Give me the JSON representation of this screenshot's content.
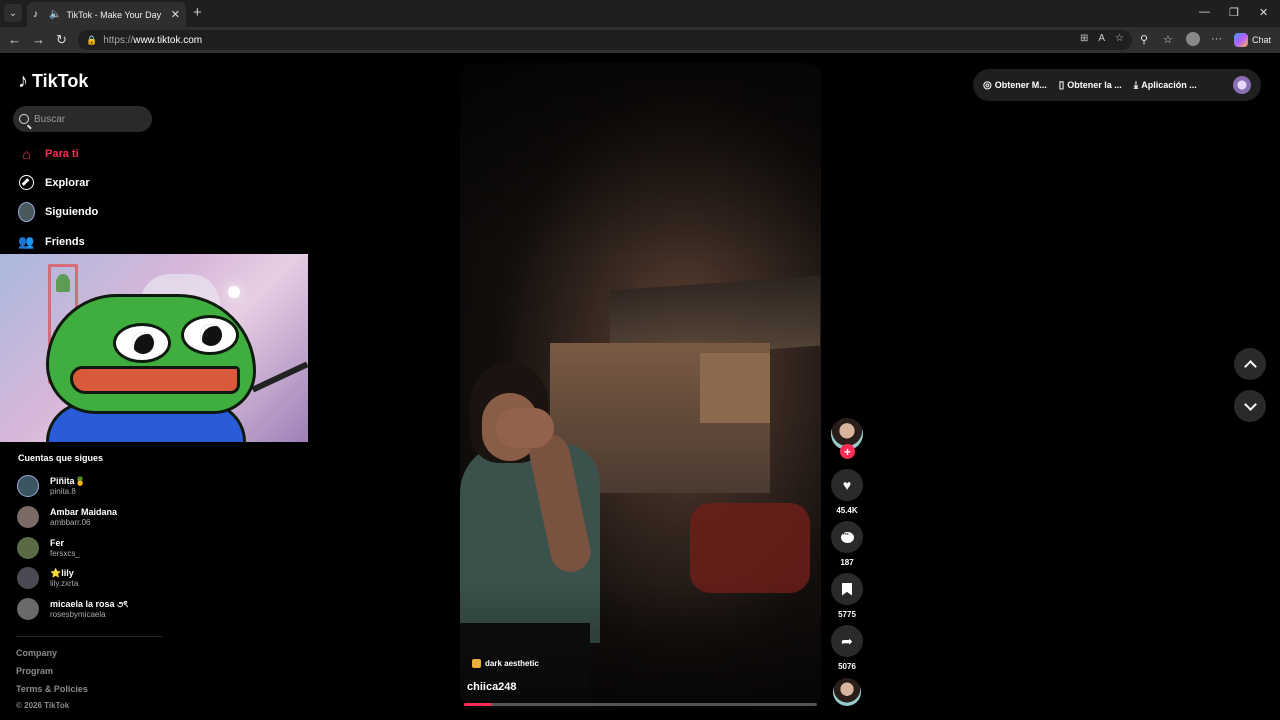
{
  "browser": {
    "tab_title": "TikTok - Make Your Day",
    "url_prefix": "https://",
    "url_domain": "www.tiktok.com",
    "chat_label": "Chat"
  },
  "sidebar": {
    "logo_text": "TikTok",
    "search_placeholder": "Buscar",
    "nav": [
      {
        "label": "Para ti",
        "icon": "home-icon",
        "active": true
      },
      {
        "label": "Explorar",
        "icon": "compass-icon"
      },
      {
        "label": "Siguiendo",
        "icon": "following-avatar"
      },
      {
        "label": "Friends",
        "icon": "friends-icon"
      }
    ],
    "following_title": "Cuentas que sigues",
    "accounts": [
      {
        "name": "Piñita🍍",
        "handle": "pinita.8",
        "color": "#3a5560"
      },
      {
        "name": "Ambar Maidana",
        "handle": "ambbarr.06",
        "color": "#7a6a66"
      },
      {
        "name": "Fer",
        "handle": "fersxcs_",
        "color": "#5a6a44"
      },
      {
        "name": "⭐lily",
        "handle": "lily.zxrta",
        "color": "#4a4a55"
      },
      {
        "name": "micaela la rosa ૭ৎ",
        "handle": "rosesbymicaela",
        "color": "#6a6a6a"
      }
    ],
    "footer": [
      "Company",
      "Program",
      "Terms & Policies"
    ],
    "copyright": "© 2026 TikTok"
  },
  "video": {
    "tag": "dark aesthetic",
    "username": "chiica248",
    "progress": 0.08
  },
  "actions": {
    "likes": "45.4K",
    "comments": "187",
    "saves": "5775",
    "shares": "5076"
  },
  "top_actions": [
    {
      "label": "Obtener M...",
      "icon": "coin-icon"
    },
    {
      "label": "Obtener la ...",
      "icon": "phone-icon"
    },
    {
      "label": "Aplicación ...",
      "icon": "download-icon"
    }
  ],
  "colors": {
    "accent": "#fe2c55",
    "background": "#000000"
  }
}
